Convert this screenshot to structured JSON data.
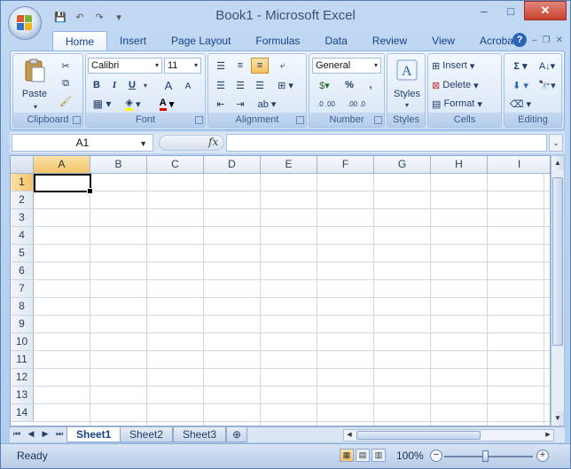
{
  "window": {
    "title": "Book1 - Microsoft Excel",
    "controls": {
      "minimize": "–",
      "maximize": "□",
      "close": "✕"
    }
  },
  "quick_access": {
    "save": "💾",
    "undo": "↶",
    "redo": "↷",
    "customize": "▾"
  },
  "ribbon_tabs": [
    "Home",
    "Insert",
    "Page Layout",
    "Formulas",
    "Data",
    "Review",
    "View",
    "Acrobat"
  ],
  "ribbon_right": {
    "help": "?",
    "min": "–",
    "restore": "❐",
    "close": "✕"
  },
  "groups": {
    "clipboard": {
      "label": "Clipboard",
      "paste": "Paste"
    },
    "font": {
      "label": "Font",
      "font_name": "Calibri",
      "font_size": "11",
      "bold": "B",
      "italic": "I",
      "underline": "U",
      "grow": "A",
      "shrink": "A"
    },
    "alignment": {
      "label": "Alignment"
    },
    "number": {
      "label": "Number",
      "format": "General",
      "percent": "%",
      "comma": ",",
      "inc": ".0 .00",
      "dec": ".00 .0"
    },
    "styles": {
      "label": "Styles"
    },
    "cells": {
      "label": "Cells",
      "insert": "Insert",
      "delete": "Delete",
      "format": "Format"
    },
    "editing": {
      "label": "Editing"
    }
  },
  "formula_bar": {
    "name_box": "A1",
    "fx": "fx",
    "formula": ""
  },
  "columns": [
    "A",
    "B",
    "C",
    "D",
    "E",
    "F",
    "G",
    "H",
    "I"
  ],
  "rows": [
    "1",
    "2",
    "3",
    "4",
    "5",
    "6",
    "7",
    "8",
    "9",
    "10",
    "11",
    "12",
    "13",
    "14"
  ],
  "selected_cell": "A1",
  "sheets": [
    "Sheet1",
    "Sheet2",
    "Sheet3"
  ],
  "active_sheet": "Sheet1",
  "status": {
    "text": "Ready",
    "zoom": "100%"
  }
}
